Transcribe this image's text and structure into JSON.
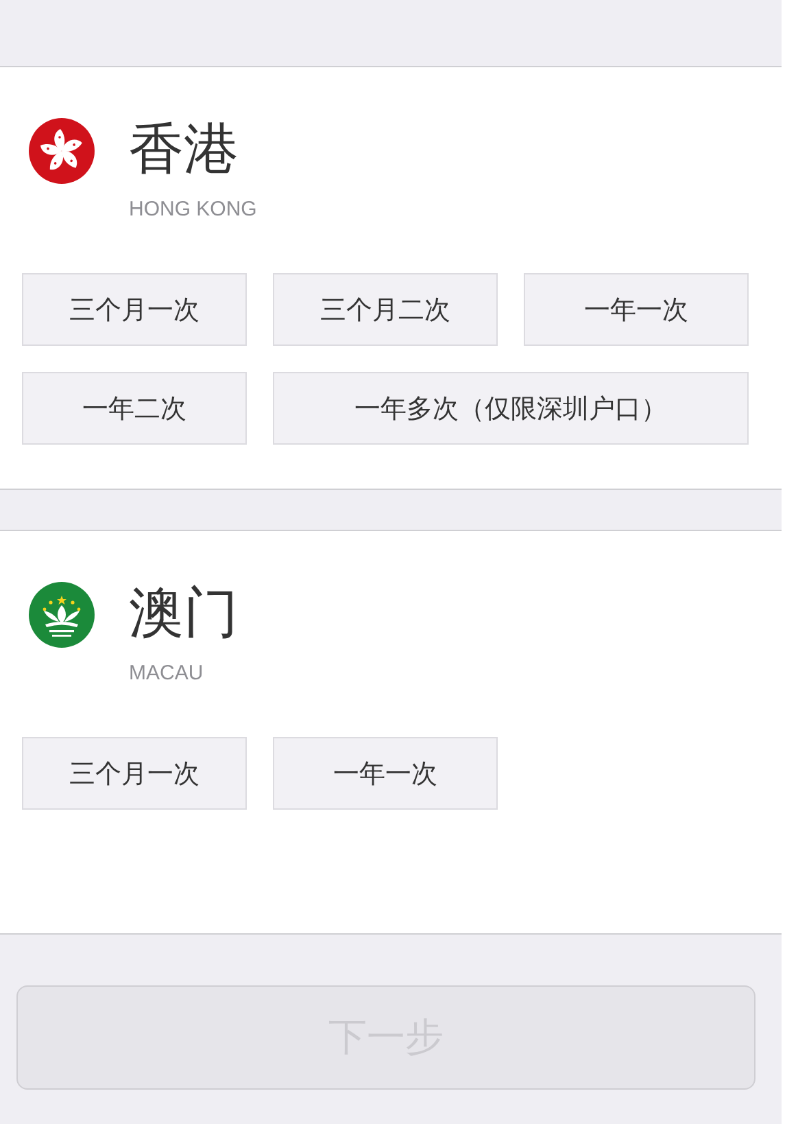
{
  "regions": [
    {
      "kind": "hong_kong",
      "name": "香港",
      "subtitle": "HONG KONG",
      "options": [
        {
          "label": "三个月一次",
          "selected": false
        },
        {
          "label": "三个月二次",
          "selected": false
        },
        {
          "label": "一年一次",
          "selected": false
        },
        {
          "label": "一年二次",
          "selected": false
        },
        {
          "label": "一年多次（仅限深圳户口）",
          "selected": false
        }
      ]
    },
    {
      "kind": "macau",
      "name": "澳门",
      "subtitle": "MACAU",
      "options": [
        {
          "label": "三个月一次",
          "selected": false
        },
        {
          "label": "一年一次",
          "selected": false
        }
      ]
    }
  ],
  "next_button": {
    "label": "下一步",
    "disabled": true
  }
}
